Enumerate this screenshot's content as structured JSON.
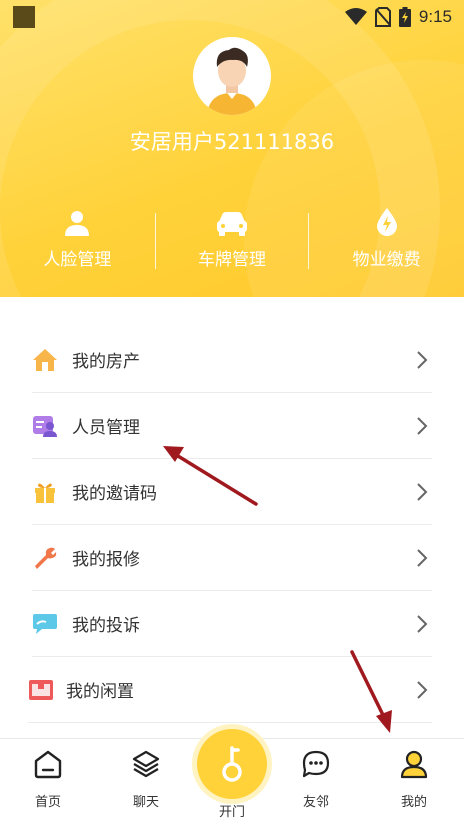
{
  "status_bar": {
    "time": "9:15"
  },
  "profile": {
    "username": "安居用户521111836"
  },
  "quick_actions": [
    {
      "label": "人脸管理",
      "icon": "person-icon"
    },
    {
      "label": "车牌管理",
      "icon": "car-icon"
    },
    {
      "label": "物业缴费",
      "icon": "water-drop-icon"
    }
  ],
  "menu": [
    {
      "label": "我的房产",
      "icon": "house-icon"
    },
    {
      "label": "人员管理",
      "icon": "people-card-icon"
    },
    {
      "label": "我的邀请码",
      "icon": "gift-icon"
    },
    {
      "label": "我的报修",
      "icon": "wrench-icon"
    },
    {
      "label": "我的投诉",
      "icon": "chat-bubble-icon"
    },
    {
      "label": "我的闲置",
      "icon": "box-icon"
    }
  ],
  "tabbar": {
    "home": "首页",
    "chat": "聊天",
    "open": "开门",
    "neighbors": "友邻",
    "mine": "我的"
  },
  "colors": {
    "accent": "#ffd23a",
    "annotation_arrow": "#a0191e"
  }
}
